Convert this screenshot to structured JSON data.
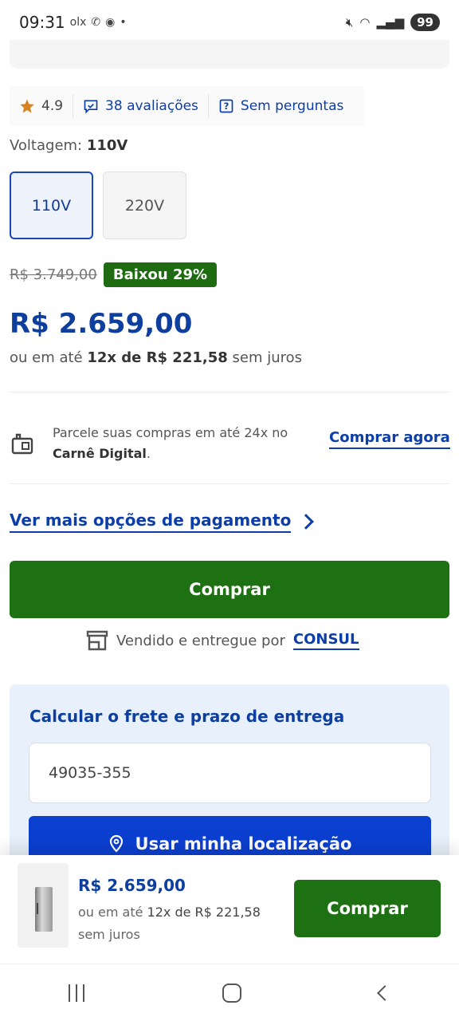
{
  "status_bar": {
    "time": "09:31",
    "notifications": "olx",
    "battery": "99"
  },
  "rating": {
    "value": "4.9",
    "reviews_label": "38 avaliações",
    "questions_label": "Sem perguntas"
  },
  "voltage": {
    "label": "Voltagem:",
    "selected": "110V",
    "options": [
      "110V",
      "220V"
    ]
  },
  "price": {
    "old": "R$ 3.749,00",
    "discount": "Baixou 29%",
    "current": "R$ 2.659,00",
    "installments_prefix": "ou em até",
    "installments_bold": "12x de R$ 221,58",
    "installments_suffix": "sem juros"
  },
  "carne": {
    "text": "Parcele suas compras em até 24x no",
    "brand": "Carnê Digital",
    "link": "Comprar agora"
  },
  "payment_options_link": "Ver mais opções de pagamento",
  "buy_button": "Comprar",
  "seller": {
    "prefix": "Vendido e entregue por",
    "name": "CONSUL"
  },
  "freight": {
    "title": "Calcular o frete e prazo de entrega",
    "cep_value": "49035-355",
    "location_button": "Usar minha localização"
  },
  "footer": {
    "price": "R$ 2.659,00",
    "installments_prefix": "ou em até",
    "installments_bold": "12x de R$ 221,58",
    "installments_suffix": "sem juros",
    "buy_button": "Comprar"
  },
  "colors": {
    "brand_blue": "#0e3f9e",
    "buy_green": "#1e7112",
    "location_blue": "#0b3fd0"
  }
}
